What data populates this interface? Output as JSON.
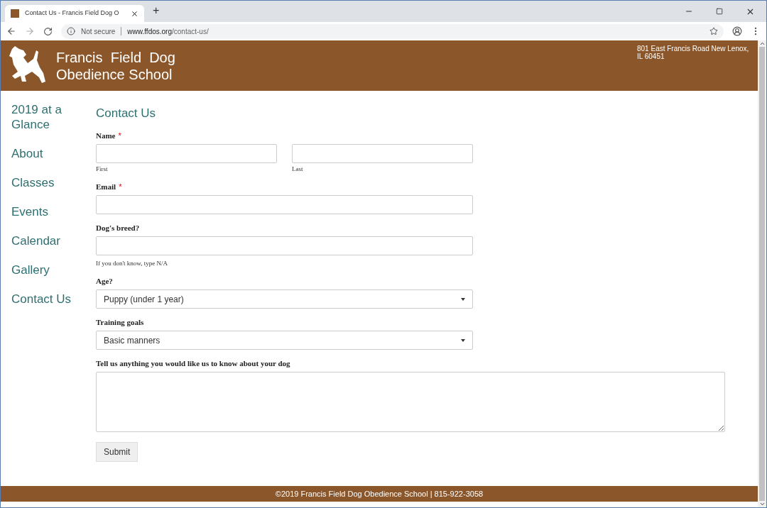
{
  "browser": {
    "tab_title": "Contact Us - Francis Field Dog O",
    "security": "Not secure",
    "url_domain": "www.ffdos.org",
    "url_path": "/contact-us/",
    "new_tab": "+"
  },
  "header": {
    "title_line_1": "Francis  Field  Dog",
    "title_line_2": "Obedience School",
    "address": "801 East Francis Road New Lenox, IL 60451"
  },
  "sidebar": {
    "items": [
      {
        "label": "2019 at a Glance"
      },
      {
        "label": "About"
      },
      {
        "label": "Classes"
      },
      {
        "label": "Events"
      },
      {
        "label": "Calendar"
      },
      {
        "label": "Gallery"
      },
      {
        "label": "Contact Us"
      }
    ]
  },
  "page_title": "Contact Us",
  "required_mark": "*",
  "form": {
    "fields": [
      {
        "kind": "name",
        "label": "Name",
        "required": true,
        "sublabels": [
          "First",
          "Last"
        ]
      },
      {
        "kind": "text",
        "label": "Email",
        "required": true
      },
      {
        "kind": "text",
        "label": "Dog's breed?",
        "required": false,
        "hint": "If you don't know, type N/A"
      },
      {
        "kind": "select",
        "label": "Age?",
        "required": false,
        "value": "Puppy (under 1 year)"
      },
      {
        "kind": "select",
        "label": "Training goals",
        "required": false,
        "value": "Basic manners"
      },
      {
        "kind": "textarea",
        "label": "Tell us anything you would like us to know about your dog",
        "required": false
      }
    ],
    "submit": "Submit"
  },
  "footer": "©2019 Francis Field Dog Obedience School | 815-922-3058"
}
